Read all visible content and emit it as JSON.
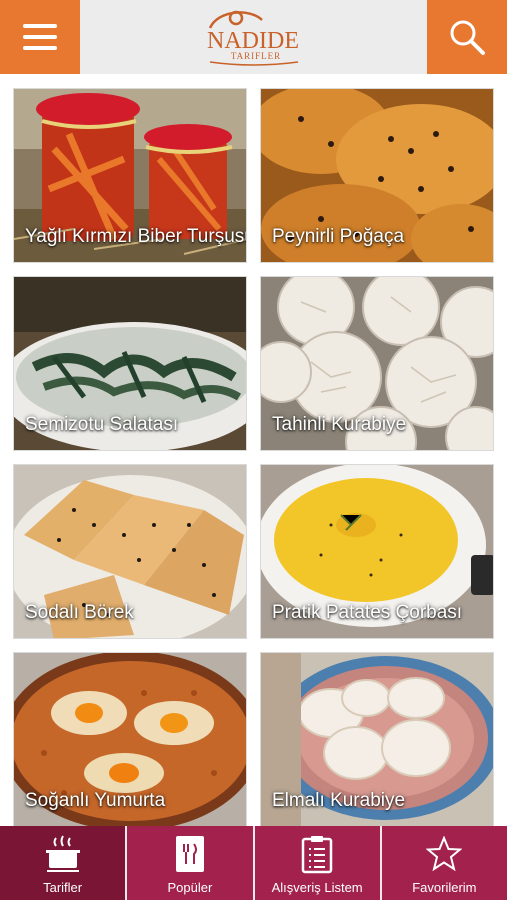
{
  "header": {
    "logo_text": "NADIDE",
    "logo_sub": "TARIFLER",
    "menu_icon": "hamburger-icon",
    "search_icon": "search-icon",
    "accent": "#e87730"
  },
  "recipes": [
    {
      "title": "Yağlı Kırmızı Biber Turşusu"
    },
    {
      "title": "Peynirli Poğaça"
    },
    {
      "title": "Semizotu Salatası"
    },
    {
      "title": "Tahinli Kurabiye"
    },
    {
      "title": "Sodalı Börek"
    },
    {
      "title": "Pratik Patates Çorbası"
    },
    {
      "title": "Soğanlı Yumurta"
    },
    {
      "title": "Elmalı Kurabiye"
    }
  ],
  "bottom_nav": [
    {
      "label": "Tarifler",
      "icon": "cooking-pot-icon"
    },
    {
      "label": "Popüler",
      "icon": "recipe-book-icon"
    },
    {
      "label": "Alışveriş Listem",
      "icon": "clipboard-list-icon"
    },
    {
      "label": "Favorilerim",
      "icon": "star-icon"
    }
  ],
  "colors": {
    "nav_bg": "#8c1a3e",
    "nav_active": "#7a1535"
  }
}
